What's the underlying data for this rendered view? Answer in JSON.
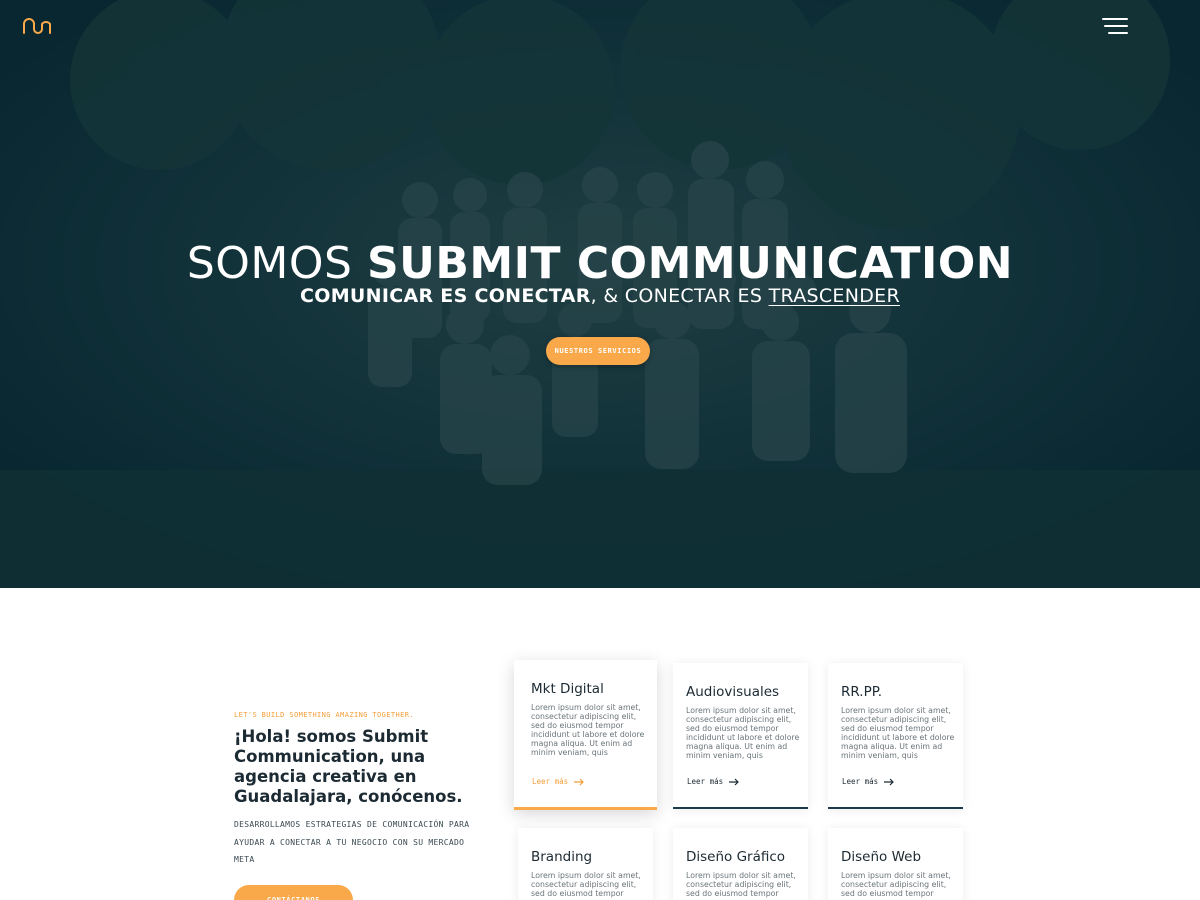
{
  "nav": {
    "logo": "logo-icon",
    "menu": "hamburger-menu-icon"
  },
  "hero": {
    "title_light": "SOMOS ",
    "title_bold": "SUBMIT COMMUNICATION",
    "subtitle_bold": "COMUNICAR ES CONECTAR",
    "subtitle_mid": ", & CONECTAR ES ",
    "subtitle_underlined": "TRASCENDER",
    "cta_label": "NUESTROS SERVICIOS"
  },
  "about": {
    "kicker": "LET'S BUILD SOMETHING AMAZING TOGETHER.",
    "heading_1": "¡Hola! somos ",
    "heading_bold": "Submit Communication",
    "heading_2": ", una agencia creativa en Guadalajara, ",
    "heading_bold_2": "conócenos.",
    "description": "DESARROLLAMOS ESTRATEGIAS DE COMUNICACIÓN PARA AYUDAR A CONECTAR A TU NEGOCIO CON SU MERCADO META",
    "cta_label": "CONTÁCTANOS"
  },
  "services": [
    {
      "title": "Mkt Digital",
      "text": "Lorem ipsum dolor sit amet, consectetur adipiscing elit, sed do eiusmod tempor incididunt ut labore et dolore magna aliqua. Ut enim ad minim veniam, quis",
      "link": "Leer más"
    },
    {
      "title": "Audiovisuales",
      "text": "Lorem ipsum dolor sit amet, consectetur adipiscing elit, sed do eiusmod tempor incididunt ut labore et dolore magna aliqua. Ut enim ad minim veniam, quis",
      "link": "Leer más"
    },
    {
      "title": "RR.PP.",
      "text": "Lorem ipsum dolor sit amet, consectetur adipiscing elit, sed do eiusmod tempor incididunt ut labore et dolore magna aliqua. Ut enim ad minim veniam, quis",
      "link": "Leer más"
    },
    {
      "title": "Branding",
      "text": "Lorem ipsum dolor sit amet, consectetur adipiscing elit, sed do eiusmod tempor",
      "link": ""
    },
    {
      "title": "Diseño Gráfico",
      "text": "Lorem ipsum dolor sit amet, consectetur adipiscing elit, sed do eiusmod tempor",
      "link": ""
    },
    {
      "title": "Diseño Web",
      "text": "Lorem ipsum dolor sit amet, consectetur adipiscing elit, sed do eiusmod tempor",
      "link": ""
    }
  ],
  "colors": {
    "accent": "#f9a84a",
    "hero_overlay": "#0f2d38",
    "dark": "#1c2a33"
  }
}
